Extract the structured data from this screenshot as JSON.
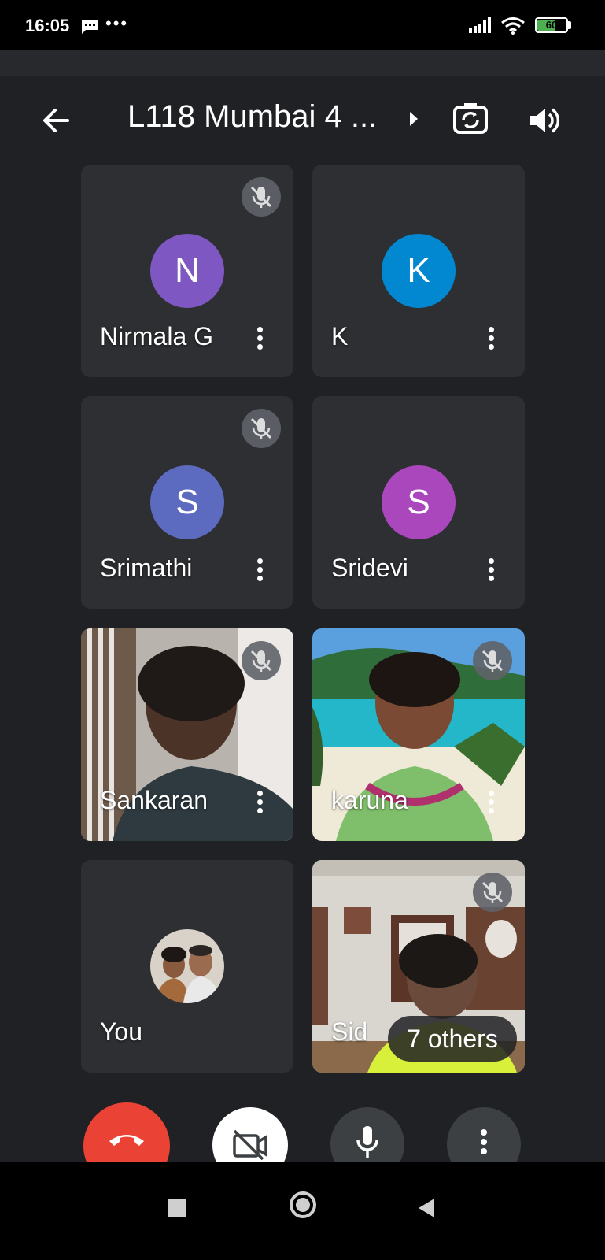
{
  "status_bar": {
    "time": "16:05",
    "overflow_dots": "•••",
    "battery_level": "60"
  },
  "header": {
    "meeting_title": "L118 Mumbai 4 ..."
  },
  "participants": [
    {
      "name": "Nirmala G",
      "initial": "N",
      "avatar_color": "#7e57c2",
      "muted": true
    },
    {
      "name": "K",
      "initial": "K",
      "avatar_color": "#0288d1",
      "muted": false
    },
    {
      "name": "Srimathi",
      "initial": "S",
      "avatar_color": "#5c6bc0",
      "muted": true
    },
    {
      "name": "Sridevi",
      "initial": "S",
      "avatar_color": "#ab47bc",
      "muted": false
    },
    {
      "name": "Sankaran",
      "muted": true,
      "video": true
    },
    {
      "name": "karuna",
      "muted": true,
      "video": true
    },
    {
      "name": "You",
      "muted": false,
      "photo_avatar": true
    },
    {
      "name": "Sid",
      "muted": true,
      "video": true
    }
  ],
  "others_count_label": "7 others",
  "colors": {
    "background": "#202124",
    "tile": "#2e2f32",
    "end_call": "#ea4335",
    "control_dark": "#3c4043"
  }
}
